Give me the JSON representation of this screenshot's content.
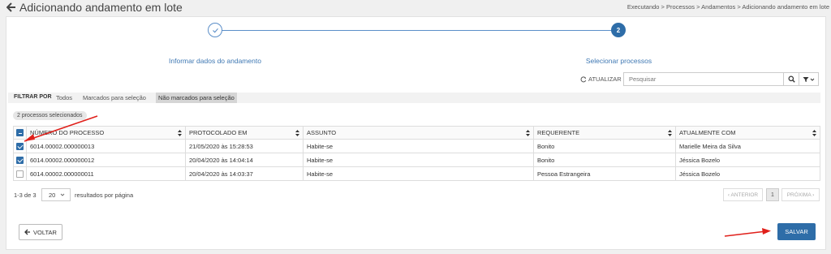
{
  "header": {
    "title": "Adicionando andamento em lote",
    "breadcrumb": "Executando > Processos > Andamentos > Adicionando andamento em lote"
  },
  "stepper": {
    "steps": [
      {
        "label": "Informar dados do andamento",
        "status": "done"
      },
      {
        "number": "2",
        "label": "Selecionar processos",
        "status": "active"
      }
    ]
  },
  "toolbar": {
    "refresh_label": "ATUALIZAR",
    "search_placeholder": "Pesquisar"
  },
  "filters": {
    "label": "FILTRAR POR",
    "options": [
      "Todos",
      "Marcados para seleção",
      "Não marcados para seleção"
    ],
    "active_index": 2
  },
  "selection_badge": "2 processos selecionados",
  "table": {
    "columns": [
      "NÚMERO DO PROCESSO",
      "PROTOCOLADO EM",
      "ASSUNTO",
      "REQUERENTE",
      "ATUALMENTE COM"
    ],
    "rows": [
      {
        "checked": true,
        "cells": [
          "6014.00002.000000013",
          "21/05/2020 às 15:28:53",
          "Habite-se",
          "Bonito",
          "Marielle Meira da Silva"
        ]
      },
      {
        "checked": true,
        "cells": [
          "6014.00002.000000012",
          "20/04/2020 às 14:04:14",
          "Habite-se",
          "Bonito",
          "Jéssica Bozelo"
        ]
      },
      {
        "checked": false,
        "cells": [
          "6014.00002.000000011",
          "20/04/2020 às 14:03:37",
          "Habite-se",
          "Pessoa Estrangeira",
          "Jéssica Bozelo"
        ]
      }
    ]
  },
  "pagination": {
    "range": "1-3 de 3",
    "page_size": "20",
    "per_page_label": "resultados por página",
    "prev": "‹ ANTERIOR",
    "current": "1",
    "next": "PRÓXIMA ›"
  },
  "footer": {
    "back_label": "VOLTAR",
    "save_label": "SALVAR"
  },
  "colors": {
    "accent": "#2e6da8",
    "annotation_arrow": "#e0201b"
  },
  "icons": [
    "back-arrow-icon",
    "check-icon",
    "refresh-icon",
    "search-icon",
    "filter-icon",
    "sort-icon",
    "chevron-down-icon"
  ]
}
